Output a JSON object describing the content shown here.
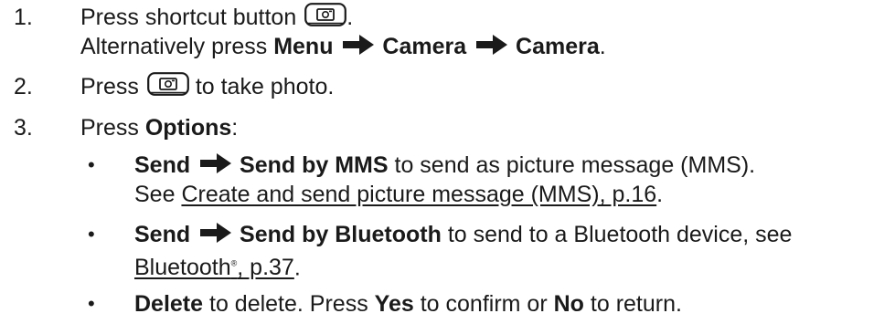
{
  "steps": [
    {
      "number": "1.",
      "line1_pre": "Press shortcut button",
      "line1_post": ".",
      "line2_pre": "Alternatively press",
      "line2_menu": "Menu",
      "line2_camera1": "Camera",
      "line2_camera2": "Camera",
      "line2_end": "."
    },
    {
      "number": "2.",
      "pre": "Press",
      "post": "to take photo."
    },
    {
      "number": "3.",
      "pre": "Press",
      "bold": "Options",
      "post": ":"
    }
  ],
  "bullets": [
    {
      "bullet": "•",
      "bold1": "Send",
      "bold2": "Send by MMS",
      "text": "to send as picture message (MMS).",
      "line2_pre": "See",
      "link": "Create and send picture message (MMS), p.16",
      "line2_end": "."
    },
    {
      "bullet": "•",
      "bold1": "Send",
      "bold2": "Send by Bluetooth",
      "text": "to send to a Bluetooth device, see",
      "link_pre": "Bluetooth",
      "link_sup": "®",
      "link_post": ", p.37",
      "line2_end": "."
    },
    {
      "bullet": "•",
      "bold1": "Delete",
      "text1": "to delete. Press",
      "bold2": "Yes",
      "text2": "to confirm or",
      "bold3": "No",
      "text3": "to return."
    }
  ],
  "icons": {
    "arrow": "right-arrow-icon",
    "camera_key": "camera-key-icon"
  },
  "colors": {
    "text": "#1a1a1a",
    "background": "#ffffff"
  }
}
